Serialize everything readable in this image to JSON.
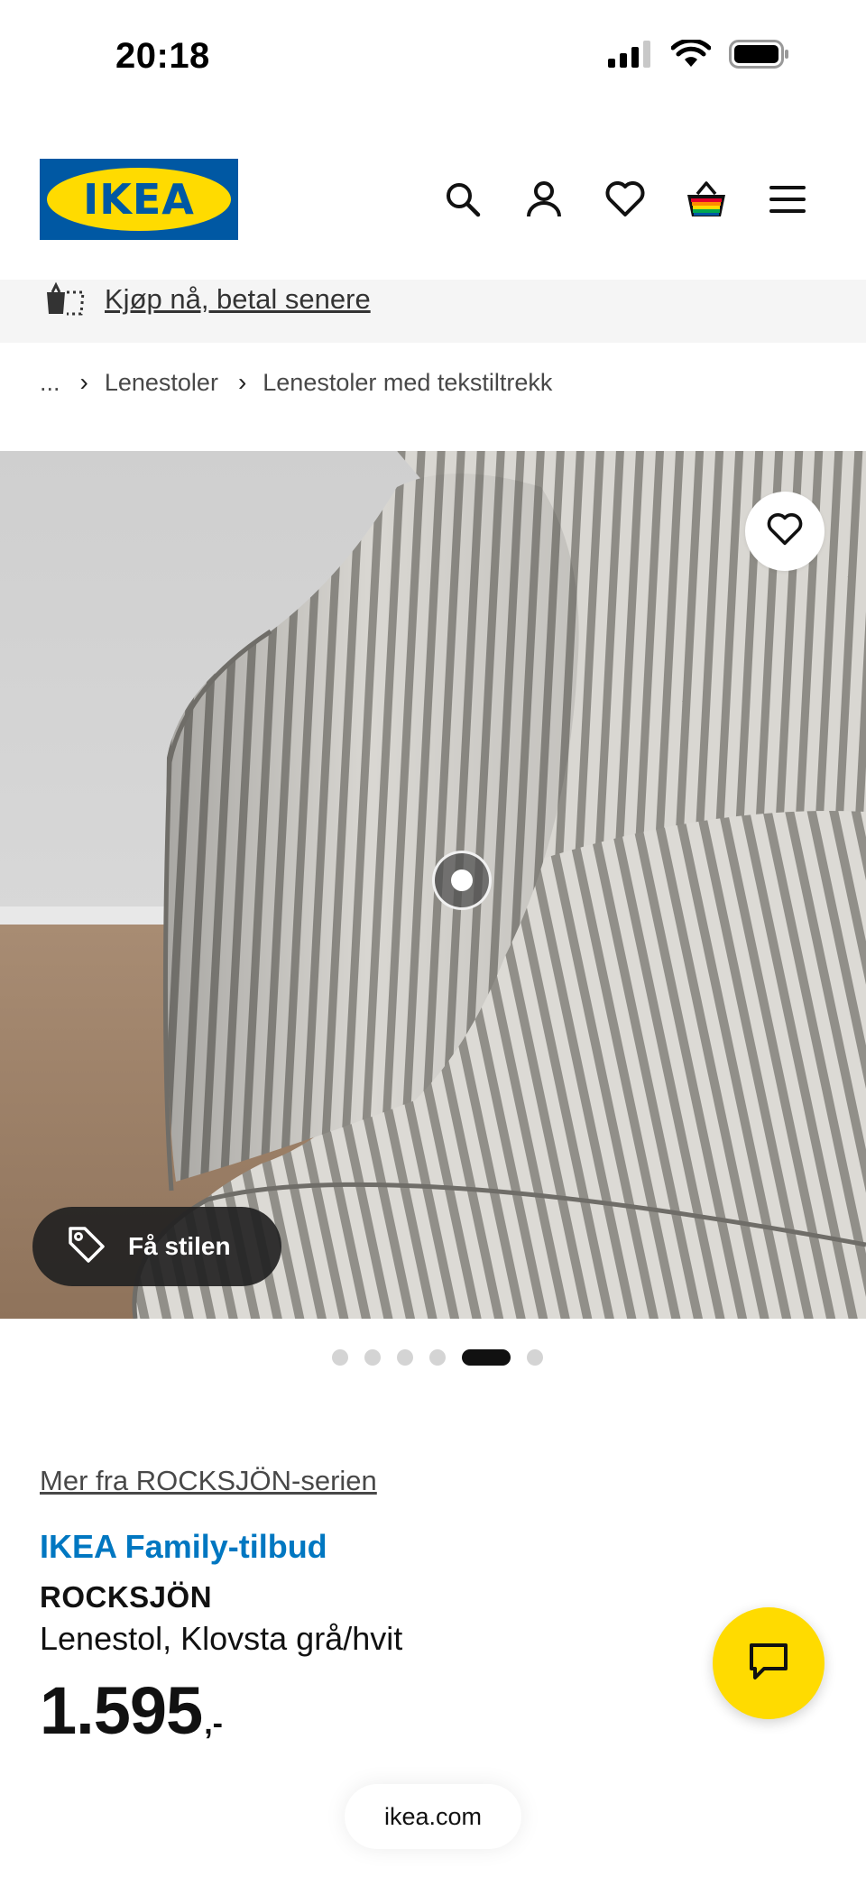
{
  "status_bar": {
    "time": "20:18"
  },
  "header": {
    "logo_text": "IKEA",
    "icons": [
      "search-icon",
      "profile-icon",
      "heart-icon",
      "basket-icon",
      "menu-icon"
    ]
  },
  "promo": {
    "label": "Kjøp nå, betal senere",
    "icon": "bag-icon"
  },
  "breadcrumb": {
    "ellipsis": "...",
    "items": [
      "Lenestoler",
      "Lenestoler med tekstiltrekk"
    ]
  },
  "gallery": {
    "style_button_label": "Få stilen",
    "image_count": 6,
    "active_index": 4
  },
  "product": {
    "series_link": "Mer fra ROCKSJÖN-serien",
    "offer_label": "IKEA Family-tilbud",
    "name": "ROCKSJÖN",
    "description": "Lenestol, Klovsta grå/hvit",
    "price": "1.595",
    "price_suffix": ",-"
  },
  "browser": {
    "url": "ikea.com"
  },
  "colors": {
    "ikea_blue": "#0058a3",
    "ikea_yellow": "#ffdb00",
    "family_blue": "#0077c1"
  }
}
